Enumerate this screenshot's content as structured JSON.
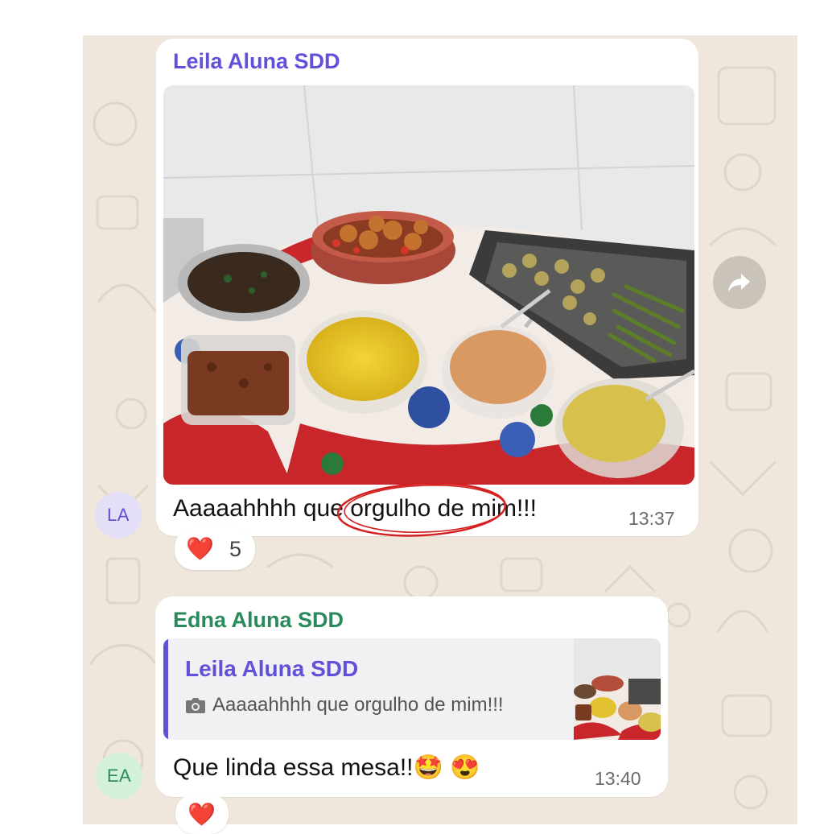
{
  "colors": {
    "chat_background": "#efe7dc",
    "sender1_color": "#6150d8",
    "sender2_color": "#2a8a5c",
    "avatar1_bg": "#e4def7",
    "avatar2_bg": "#d3f1d8",
    "annotation_red": "#d42020"
  },
  "messages": [
    {
      "sender": "Leila Aluna SDD",
      "avatar_initials": "LA",
      "attachment": "photo",
      "text": "Aaaaahhhh que orgulho de mim!!!",
      "time": "13:37",
      "reaction": {
        "emoji": "❤️",
        "count": "5"
      }
    },
    {
      "sender": "Edna Aluna SDD",
      "avatar_initials": "EA",
      "reply_to": {
        "sender": "Leila Aluna SDD",
        "icon": "camera-icon",
        "text": "Aaaaahhhh que orgulho de mim!!!"
      },
      "text": "Que linda essa mesa!!🤩 😍",
      "time": "13:40",
      "reaction": {
        "emoji": "❤️"
      }
    }
  ],
  "icons": {
    "forward": "forward-arrow-icon"
  }
}
